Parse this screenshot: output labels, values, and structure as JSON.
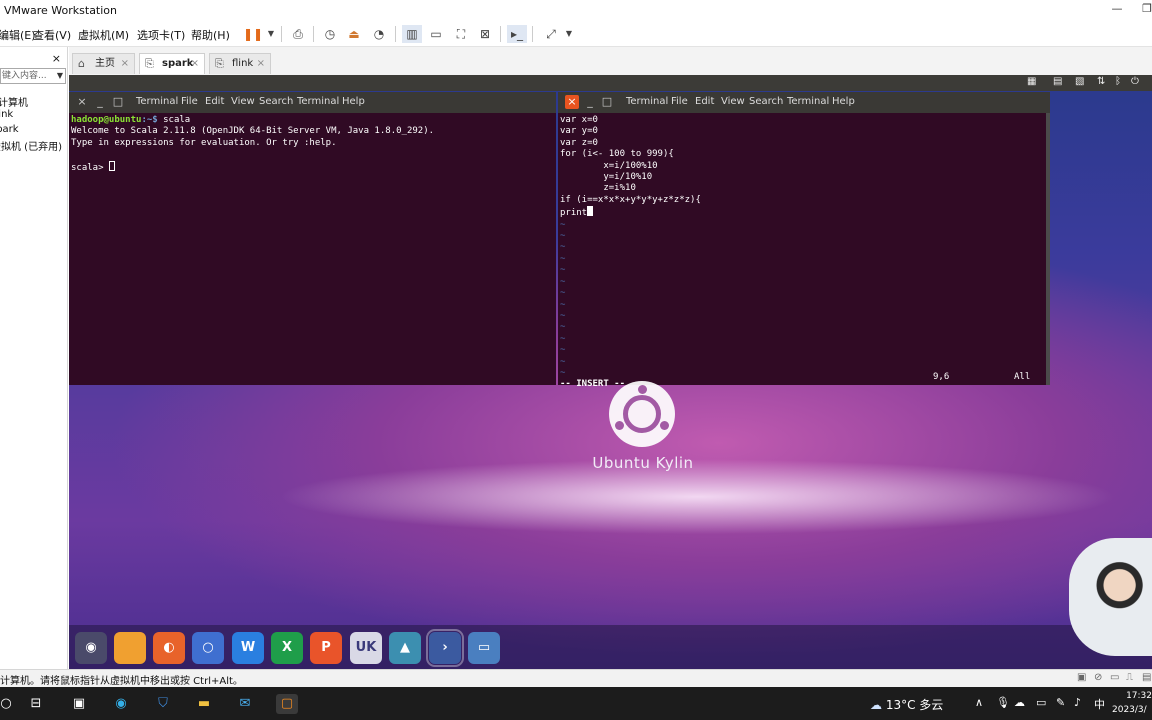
{
  "vmware": {
    "title": "VMware Workstation",
    "menus": [
      "编辑(E)",
      "查看(V)",
      "虚拟机(M)",
      "选项卡(T)",
      "帮助(H)"
    ],
    "window_buttons": {
      "minimize": "—",
      "restore": "❐"
    }
  },
  "library": {
    "close_label": "×",
    "search_placeholder": "键入内容...",
    "items": [
      "计算机",
      "flink",
      "spark",
      "虚拟机 (已弃用)"
    ]
  },
  "tabs": [
    {
      "label": "主页",
      "icon": "home-icon",
      "active": false
    },
    {
      "label": "spark",
      "icon": "vm-icon",
      "active": true
    },
    {
      "label": "flink",
      "icon": "vm-icon",
      "active": false
    }
  ],
  "terminal_left": {
    "menu": [
      "Terminal",
      "File",
      "Edit",
      "View",
      "Search",
      "Terminal",
      "Help"
    ],
    "prompt_user": "hadoop@ubuntu",
    "prompt_path": ":~$",
    "command": " scala",
    "output": [
      "Welcome to Scala 2.11.8 (OpenJDK 64-Bit Server VM, Java 1.8.0_292).",
      "Type in expressions for evaluation. Or try :help."
    ],
    "repl_prompt": "scala> "
  },
  "terminal_right": {
    "menu": [
      "Terminal",
      "File",
      "Edit",
      "View",
      "Search",
      "Terminal",
      "Help"
    ],
    "lines": [
      "var x=0",
      "var y=0",
      "var z=0",
      "for (i<- 100 to 999){",
      "        x=i/100%10",
      "        y=i/10%10",
      "        z=i%10",
      "if (i==x*x*x+y*y*y+z*z*z){",
      "print"
    ],
    "tilde_count": 14,
    "mode": "-- INSERT --",
    "position": "9,6",
    "scroll": "All"
  },
  "desktop": {
    "brand": "Ubuntu Kylin"
  },
  "dock": [
    {
      "name": "ukui-menu-icon",
      "glyph": "◉",
      "color": "#4a4a6a"
    },
    {
      "name": "files-icon",
      "glyph": "",
      "color": "#f0a030"
    },
    {
      "name": "firefox-icon",
      "glyph": "◐",
      "color": "#e8632a"
    },
    {
      "name": "chromium-icon",
      "glyph": "○",
      "color": "#3f6fd0"
    },
    {
      "name": "wps-writer-icon",
      "glyph": "W",
      "color": "#2a7fe0"
    },
    {
      "name": "wps-spreadsheet-icon",
      "glyph": "X",
      "color": "#1f9e4a"
    },
    {
      "name": "wps-presentation-icon",
      "glyph": "P",
      "color": "#e9542a"
    },
    {
      "name": "software-center-icon",
      "glyph": "UK",
      "color": "#d9d9e6"
    },
    {
      "name": "kylin-assistant-icon",
      "glyph": "▲",
      "color": "#3c8fb0"
    },
    {
      "name": "terminal-icon",
      "glyph": "›",
      "color": "#3b5aa0"
    },
    {
      "name": "show-desktop-icon",
      "glyph": "▭",
      "color": "#4a7fc0"
    }
  ],
  "status": {
    "message": "计算机。请将鼠标指针从虚拟机中移出或按 Ctrl+Alt。"
  },
  "taskbar": {
    "weather": "13°C  多云",
    "ime": "中",
    "time": "17:32",
    "date": "2023/3/"
  }
}
